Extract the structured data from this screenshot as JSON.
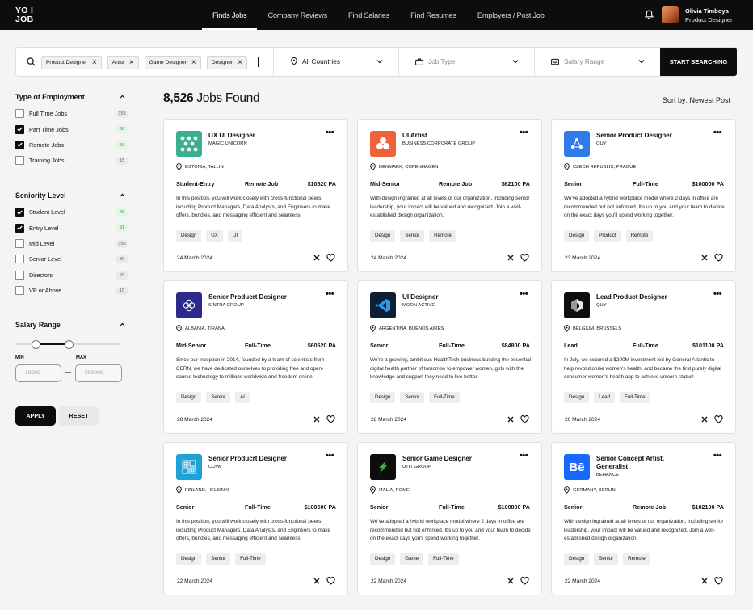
{
  "brand": {
    "logo": "YO I\nJOB"
  },
  "nav": {
    "links": [
      "Finds Jobs",
      "Company Reviews",
      "Find Salaries",
      "Find Resumes",
      "Employers / Post Job"
    ]
  },
  "user": {
    "name": "Olivia Timboya",
    "role": "Product Designer"
  },
  "search": {
    "chips": [
      "Product Designer",
      "Artist",
      "Game Designer",
      "Designer"
    ],
    "country": "All Countries",
    "job_type_placeholder": "Job Type",
    "salary_placeholder": "Salary Range",
    "button": "START SEARCHING"
  },
  "filters": {
    "employment": {
      "title": "Type of Employment",
      "items": [
        {
          "label": "Full Time Jobs",
          "count": "159",
          "checked": false
        },
        {
          "label": "Part Time Jobs",
          "count": "38",
          "checked": true
        },
        {
          "label": "Remote Jobs",
          "count": "50",
          "checked": true
        },
        {
          "label": "Training Jobs",
          "count": "15",
          "checked": false
        }
      ]
    },
    "seniority": {
      "title": "Seniority Level",
      "items": [
        {
          "label": "Student Level",
          "count": "48",
          "checked": true
        },
        {
          "label": "Entry Level",
          "count": "91",
          "checked": true
        },
        {
          "label": "Mid Level",
          "count": "150",
          "checked": false
        },
        {
          "label": "Senior Level",
          "count": "30",
          "checked": false
        },
        {
          "label": "Directors",
          "count": "20",
          "checked": false
        },
        {
          "label": "VP or Above",
          "count": "15",
          "checked": false
        }
      ]
    },
    "salary": {
      "title": "Salary Range",
      "min_label": "MIN",
      "max_label": "MAX",
      "min_placeholder": "10000",
      "max_placeholder": "500000"
    },
    "apply": "APPLY",
    "reset": "RESET"
  },
  "results": {
    "count": "8,526",
    "label": "Jobs Found",
    "sort": "Sort by: Newest Post"
  },
  "jobs": [
    {
      "title": "UX UI Designer",
      "company": "MAGIC UNICORN",
      "location": "ESTONIA, TALLIN",
      "level": "Student-Entry",
      "type": "Remote Job",
      "salary": "$10520 PA",
      "desc": "In this position, you will work closely with cross-functional peers, including Product Managers, Data Analysts, and Engineers to make offers, bundles, and messaging efficient and seamless.",
      "tags": [
        "Design",
        "UX",
        "UI"
      ],
      "date": "24 March 2024",
      "logo_color": "#3bb08f",
      "icon": "hex-pattern-icon"
    },
    {
      "title": "UI Artist",
      "company": "BUSINESS CORPORATE GROUP",
      "location": "DENMARK, COPENHAGEN",
      "level": "Mid-Senior",
      "type": "Remote Job",
      "salary": "$62100 PA",
      "desc": "With design ingrained at all levels of our organization, including senior leadership, your impact will be valued and recognized. Join a well-established design organization.",
      "tags": [
        "Design",
        "Senior",
        "Remote"
      ],
      "date": "24 March 2024",
      "logo_color": "#f0633a",
      "icon": "circles-icon"
    },
    {
      "title": "Senior Product Designer",
      "company": "QUY",
      "location": "CZECH REPUBLIC, PRAGUE",
      "level": "Senior",
      "type": "Full-Time",
      "salary": "$100000 PA",
      "desc": "We've adopted a hybrid workplace model where 2 days in office are recommended but not enforced. It's up to you and your team to decide on the exact days you'll spend working together.",
      "tags": [
        "Design",
        "Product",
        "Remote"
      ],
      "date": "23 March 2024",
      "logo_color": "#2f7be8",
      "icon": "nodes-icon"
    },
    {
      "title": "Senior Producrt Designer",
      "company": "SINTRA GROUP",
      "location": "ALBANIA, TIRANA",
      "level": "Mid-Senior",
      "type": "Full-Time",
      "salary": "$60520 PA",
      "desc": "Since our inception in 2014, founded by a team of scientists from CERN, we have dedicated ourselves to providing free and open-source technology to millions worldwide and freedom online.",
      "tags": [
        "Design",
        "Senior",
        "AI"
      ],
      "date": "28 March 2024",
      "logo_color": "#2c2a8a",
      "icon": "flower-icon"
    },
    {
      "title": "UI Designer",
      "company": "MOON ACTIVE",
      "location": "ARGENTINA, BUENOS AIRES",
      "level": "Senior",
      "type": "Full-Time",
      "salary": "$84800 PA",
      "desc": "We're a growing, ambitious HealthTech business building the essential digital health partner of tomorrow to empower women, girls with the knowledge and support they need to live better.",
      "tags": [
        "Design",
        "Senior",
        "Full-Time"
      ],
      "date": "28 March 2024",
      "logo_color": "#0d1f33",
      "icon": "code-editor-icon"
    },
    {
      "title": "Lead Product Designer",
      "company": "QUY",
      "location": "BELGIUM, BRUSSELS",
      "level": "Lead",
      "type": "Full-Time",
      "salary": "$101100 PA",
      "desc": "In July, we secured a $200M investment led by General Atlantic to help revolutionise women's health, and became the first purely digital consumer women's health app to achieve unicorn status!",
      "tags": [
        "Design",
        "Lead",
        "Full-Time"
      ],
      "date": "26 March 2024",
      "logo_color": "#0d0d0d",
      "icon": "hexagon-icon"
    },
    {
      "title": "Senior Producrt Designer",
      "company": "COWI",
      "location": "FINLAND, HELSINKI",
      "level": "Senior",
      "type": "Full-Time",
      "salary": "$100500 PA",
      "desc": "In this position, you will work closely with cross-functional peers, including Product Managers, Data Analysts, and Engineers to make offers, bundles, and messaging efficient and seamless.",
      "tags": [
        "Design",
        "Senior",
        "Full-Time"
      ],
      "date": "22 March 2024",
      "logo_color": "#1fa3d6",
      "icon": "grid-pattern-icon"
    },
    {
      "title": "Senior Game Designer",
      "company": "UTIT GROUP",
      "location": "ITALIA, ROME",
      "level": "Senior",
      "type": "Full-Time",
      "salary": "$100800 PA",
      "desc": "We've adopted a hybrid workplace model where 2 days in office are recommended but not enforced. It's up to you and your team to decide on the exact days you'll spend working together.",
      "tags": [
        "Design",
        "Game",
        "Full-Time"
      ],
      "date": "22 March 2024",
      "logo_color": "#0d0d0d",
      "icon": "arrow-mark-icon"
    },
    {
      "title": "Senior Concept Artist, Generalist",
      "company": "BEHANCE",
      "location": "GERMANY, BERLIN",
      "level": "Senior",
      "type": "Remote Job",
      "salary": "$102100 PA",
      "desc": "With design ingrained at all levels of our organization, including senior leadership, your impact will be valued and recognized. Join a well-established design organization.",
      "tags": [
        "Design",
        "Senior",
        "Remote"
      ],
      "date": "22 March 2024",
      "logo_color": "#1769ff",
      "icon": "behance-icon",
      "logo_text": "Bē"
    }
  ]
}
